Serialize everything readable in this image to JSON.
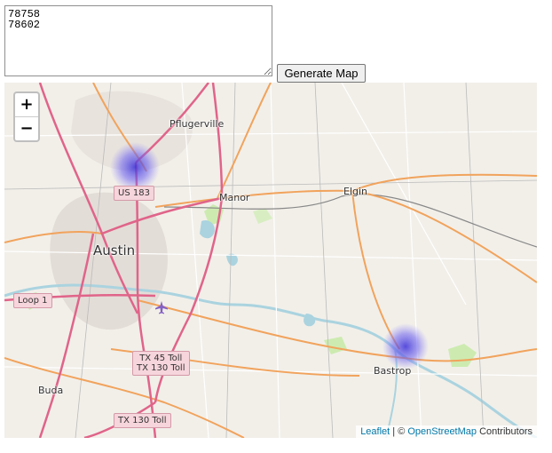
{
  "form": {
    "zip_text": "78758\n78602",
    "generate_label": "Generate Map"
  },
  "map": {
    "zoom_in": "+",
    "zoom_out": "−",
    "places": {
      "pflugerville": "Pflugerville",
      "manor": "Manor",
      "elgin": "Elgin",
      "austin": "Austin",
      "buda": "Buda",
      "bastrop": "Bastrop"
    },
    "shields": {
      "us183": "US 183",
      "loop1": "Loop 1",
      "tx45_line1": "TX 45 Toll",
      "tx45_line2": "TX 130 Toll",
      "tx130": "TX 130 Toll"
    },
    "attribution": {
      "leaflet": "Leaflet",
      "separator": " | © ",
      "osm": "OpenStreetMap",
      "suffix": " Contributors"
    },
    "heat_color": "#5a50e6",
    "airport_icon": "airplane-icon"
  }
}
